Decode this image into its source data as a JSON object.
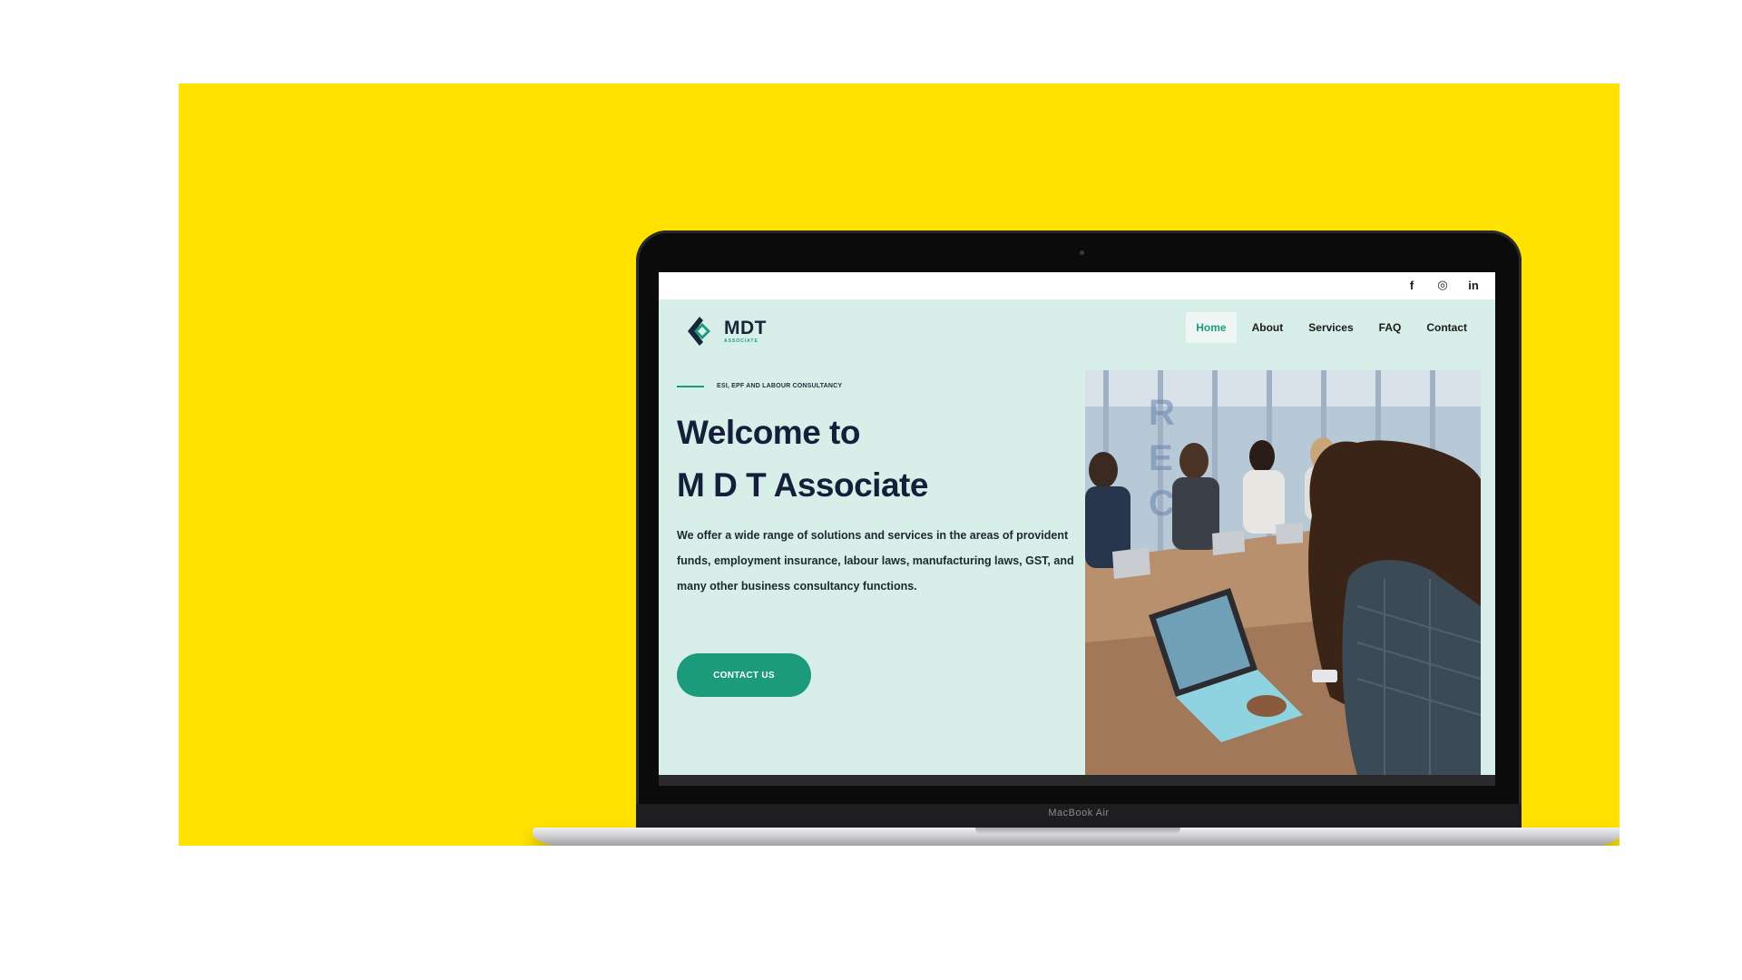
{
  "laptop": {
    "model_label": "MacBook Air"
  },
  "social": {
    "icons": [
      "facebook-icon",
      "instagram-icon",
      "linkedin-icon"
    ],
    "facebook_glyph": "f",
    "instagram_glyph": "◎",
    "linkedin_glyph": "in"
  },
  "brand": {
    "name": "MDT",
    "tagline": "ASSOCIATE",
    "accent": "#1C9A7C",
    "dark": "#16273A"
  },
  "nav": {
    "items": [
      {
        "label": "Home",
        "active": true
      },
      {
        "label": "About",
        "active": false
      },
      {
        "label": "Services",
        "active": false
      },
      {
        "label": "FAQ",
        "active": false
      },
      {
        "label": "Contact",
        "active": false
      }
    ]
  },
  "hero": {
    "eyebrow": "ESI, EPF AND LABOUR CONSULTANCY",
    "title_line1": "Welcome to",
    "title_line2": "M D T Associate",
    "description": "We offer a wide range of solutions and services in the areas of provident funds, employment insurance, labour laws, manufacturing laws, GST, and many other business consultancy functions.",
    "cta_label": "CONTACT US",
    "image": "business-meeting-photo"
  },
  "background_color": "#FFE200"
}
